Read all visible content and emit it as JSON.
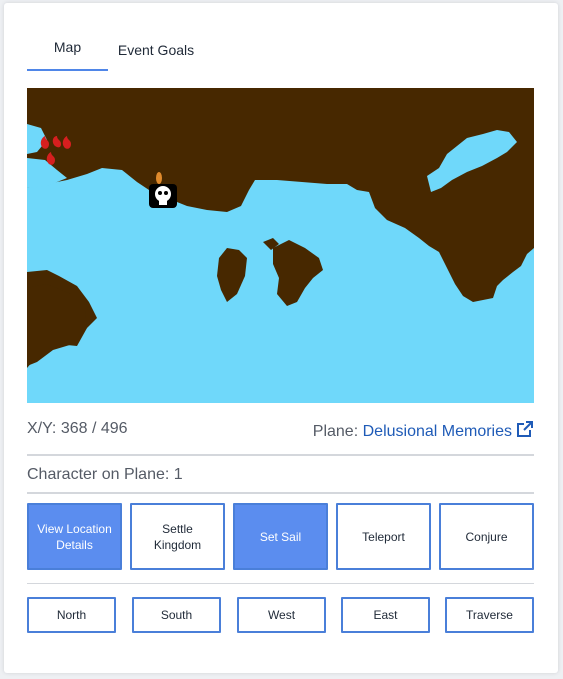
{
  "tabs": [
    {
      "label": "Map"
    },
    {
      "label": "Event Goals"
    }
  ],
  "location": {
    "xy_label": "X/Y:",
    "xy_value": "368 / 496",
    "plane_label": "Plane:",
    "plane_name": "Delusional Memories"
  },
  "characters": {
    "text": "Character on Plane: 1"
  },
  "actions": [
    {
      "label": "View Location Details"
    },
    {
      "label": "Settle Kingdom"
    },
    {
      "label": "Set Sail"
    },
    {
      "label": "Teleport"
    },
    {
      "label": "Conjure"
    }
  ],
  "movement": [
    {
      "label": "North"
    },
    {
      "label": "South"
    },
    {
      "label": "West"
    },
    {
      "label": "East"
    },
    {
      "label": "Traverse"
    }
  ],
  "colors": {
    "land": "#472800",
    "water": "#6fd8fa",
    "accent": "#5b8def",
    "link": "#1f5bb7"
  },
  "icons": {
    "player": "skull-icon",
    "enemies": "red-flame-icon",
    "external_link": "external-link-icon"
  }
}
